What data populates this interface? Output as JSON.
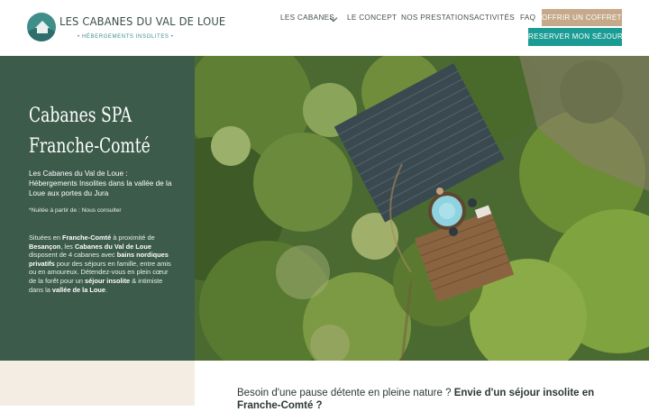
{
  "brand": {
    "title": "LES CABANES DU VAL DE LOUE",
    "subtitle": "• HÉBERGEMENTS INSOLITES •"
  },
  "nav": {
    "items": [
      {
        "label": "LES CABANES"
      },
      {
        "label": "LE CONCEPT"
      },
      {
        "label": "NOS PRESTATIONS"
      },
      {
        "label": "ACTIVITÉS"
      },
      {
        "label": "FAQ"
      }
    ],
    "gift_button": "OFFRIR UN COFFRET▯",
    "book_button": "RESERVER MON SÉJOUR ▯"
  },
  "hero": {
    "title_line1": "Cabanes SPA",
    "title_line2": "Franche-Comté",
    "lead": "Les Cabanes du Val de Loue : Hébergements Insolites dans la vallée de la Loue aux portes du Jura",
    "note": "*Nuitée à partir de : Nous consulter",
    "body": [
      {
        "t": "Situées en ",
        "b": false
      },
      {
        "t": "Franche-Comté",
        "b": true
      },
      {
        "t": " à proximité de ",
        "b": false
      },
      {
        "t": "Besançon",
        "b": true
      },
      {
        "t": ", les ",
        "b": false
      },
      {
        "t": "Cabanes du Val de Loue",
        "b": true
      },
      {
        "t": " disposent de 4 cabanes avec ",
        "b": false
      },
      {
        "t": "bains nordiques privatifs",
        "b": true
      },
      {
        "t": " pour des séjours en famille, entre amis ou en amoureux. Détendez-vous en plein cœur de la forêt pour un ",
        "b": false
      },
      {
        "t": "séjour insolite",
        "b": true
      },
      {
        "t": " & intimiste dans la ",
        "b": false
      },
      {
        "t": "vallée de la Loue",
        "b": true
      },
      {
        "t": ".",
        "b": false
      }
    ]
  },
  "intro": {
    "text": "Besoin d'une pause détente en pleine nature ? ",
    "bold": "Envie d'un séjour insolite en Franche-Comté ?"
  },
  "colors": {
    "panel": "#3c5b4b",
    "accent_teal": "#1a9b93",
    "accent_sand": "#c6a98a"
  }
}
